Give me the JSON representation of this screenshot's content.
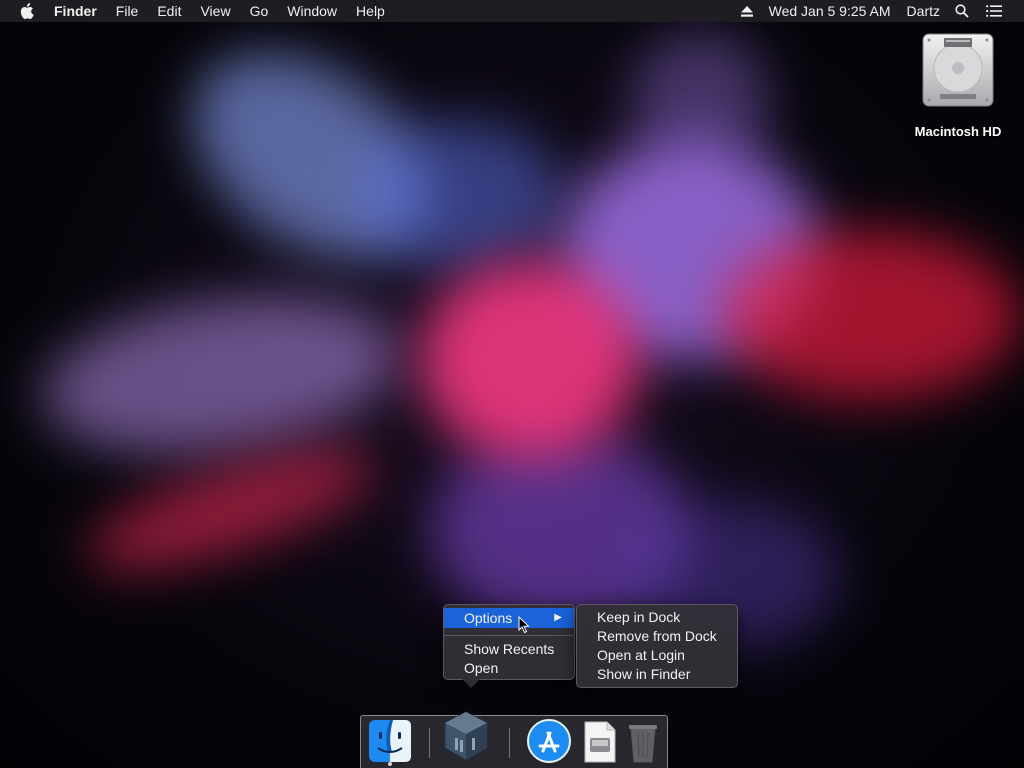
{
  "menubar": {
    "apple_icon": "apple-icon",
    "app_name": "Finder",
    "menus": [
      "File",
      "Edit",
      "View",
      "Go",
      "Window",
      "Help"
    ],
    "status": {
      "eject_icon": "eject-icon",
      "datetime": "Wed Jan 5  9:25 AM",
      "user": "Dartz",
      "search_icon": "search-icon",
      "notification_icon": "notification-center-icon"
    }
  },
  "desktop": {
    "drive_label": "Macintosh HD",
    "drive_icon": "hard-drive-icon"
  },
  "context_menu": {
    "options_label": "Options",
    "show_recents_label": "Show Recents",
    "open_label": "Open"
  },
  "options_submenu": {
    "keep_in_dock": "Keep in Dock",
    "remove_from_dock": "Remove from Dock",
    "open_at_login": "Open at Login",
    "show_in_finder": "Show in Finder"
  },
  "dock": {
    "apps": [
      {
        "name": "Finder",
        "icon": "finder-icon",
        "running": true
      },
      {
        "name": "VirtualBox",
        "icon": "virtualbox-icon",
        "running": false
      },
      {
        "name": "App Store",
        "icon": "app-store-icon",
        "running": false
      },
      {
        "name": "Document",
        "icon": "document-icon",
        "running": false
      },
      {
        "name": "Trash",
        "icon": "trash-icon",
        "running": false
      }
    ]
  },
  "colors": {
    "menubar_bg": "#1f1c22",
    "menu_highlight": "#1a63d9",
    "menu_bg": "#323036"
  }
}
